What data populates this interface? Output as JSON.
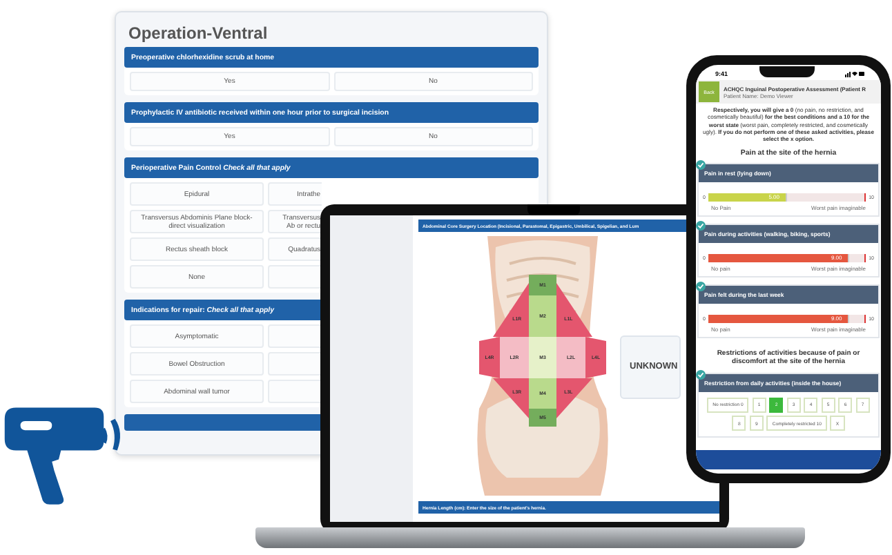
{
  "form": {
    "title": "Operation-Ventral",
    "sections": [
      {
        "title": "Preoperative chlorhexidine scrub at home",
        "kind": "choice",
        "columns": [
          [
            "Yes"
          ],
          [
            "No"
          ]
        ]
      },
      {
        "title": "Prophylactic IV antibiotic received within one hour prior to surgical incision",
        "kind": "choice",
        "columns": [
          [
            "Yes"
          ],
          [
            "No"
          ]
        ]
      },
      {
        "title": "Perioperative Pain Control *Check all that apply*",
        "kind": "checklist",
        "columns": [
          [
            "Epidural",
            "Transversus Abdominis Plane block- direct visualization",
            "Rectus sheath block",
            "None"
          ],
          [
            "Intrathe",
            "Transversus Ab or rectu",
            "Quadratus"
          ]
        ]
      },
      {
        "title": "Indications for repair: *Check all that apply*",
        "kind": "checklist",
        "columns": [
          [
            "Asymptomatic",
            "Bowel Obstruction",
            "Abdominal wall tumor"
          ]
        ]
      }
    ]
  },
  "laptop": {
    "header": "Abdominal Core Surgery Location (Incisional, Parastomal, Epigastric, Umbilical, Spigelian, and Lum",
    "zones": [
      {
        "label": "M1",
        "color": "#74ad5c"
      },
      {
        "label": "M2",
        "color": "#b9da8c"
      },
      {
        "label": "M3",
        "color": "#e6f1c9"
      },
      {
        "label": "M4",
        "color": "#b9da8c"
      },
      {
        "label": "M5",
        "color": "#74ad5c"
      },
      {
        "label": "L1R",
        "color": "#e4566e"
      },
      {
        "label": "L2R",
        "color": "#f4bcc5"
      },
      {
        "label": "L3R",
        "color": "#e4566e"
      },
      {
        "label": "L4R",
        "color": "#e4566e"
      },
      {
        "label": "L1L",
        "color": "#e4566e"
      },
      {
        "label": "L2L",
        "color": "#f4bcc5"
      },
      {
        "label": "L3L",
        "color": "#e4566e"
      },
      {
        "label": "L4L",
        "color": "#e4566e"
      }
    ],
    "unknown_button": "UNKNOWN",
    "footer": "Hernia Length (cm): Enter the size of the patient's hernia."
  },
  "phone": {
    "time": "9:41",
    "back": "Back",
    "title": "ACHQC Inguinal Postoperative Assessment (Patient R",
    "patient": "Patient Name: Demo Viewer",
    "intro": "**Respectively, you will give a 0** (no pain, no restriction, and cosmetically beautiful) **for the best conditions and a 10 for the worst state** (worst pain, completely restricted, and cosmetically ugly). **If you do not perform one of these asked activities, please select the x option.**",
    "section_title": "Pain at the site of the hernia",
    "sliders": [
      {
        "label": "Pain in rest (lying down)",
        "level": 0.5,
        "reading": "5.00",
        "color": "#c9d44a",
        "min": "0",
        "max": "10",
        "min_label": "No Pain",
        "max_label": "Worst pain imaginable"
      },
      {
        "label": "Pain during activities (walking, biking, sports)",
        "level": 0.9,
        "reading": "9.00",
        "color": "#e5573f",
        "min": "0",
        "max": "10",
        "min_label": "No pain",
        "max_label": "Worst pain imaginable"
      },
      {
        "label": "Pain felt during the last week",
        "level": 0.9,
        "reading": "9.00",
        "color": "#e5573f",
        "min": "0",
        "max": "10",
        "min_label": "No pain",
        "max_label": "Worst pain imaginable"
      }
    ],
    "restrictions_title": "Restrictions of activities because of pain or discomfort at the site of the hernia",
    "question": "Restriction from daily activities (inside the house)",
    "choices": [
      {
        "label": "No restriction 0",
        "selected": false
      },
      {
        "label": "1",
        "selected": false
      },
      {
        "label": "2",
        "selected": true
      },
      {
        "label": "3",
        "selected": false
      },
      {
        "label": "4",
        "selected": false
      },
      {
        "label": "5",
        "selected": false
      },
      {
        "label": "6",
        "selected": false
      },
      {
        "label": "7",
        "selected": false
      },
      {
        "label": "8",
        "selected": false
      },
      {
        "label": "9",
        "selected": false
      },
      {
        "label": "Completely restricted 10",
        "selected": false
      },
      {
        "label": "X",
        "selected": false
      }
    ]
  }
}
